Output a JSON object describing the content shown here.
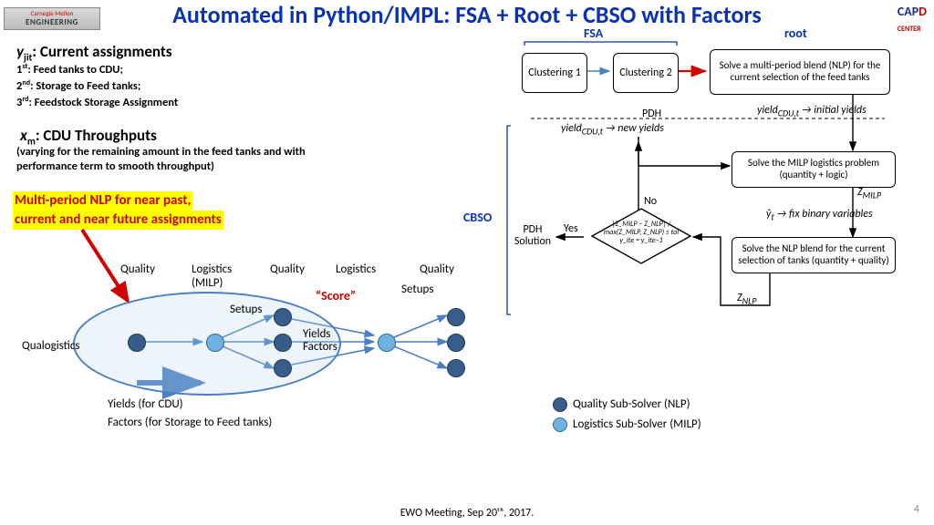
{
  "title": "Automated in Python/IMPL: FSA + Root + CBSO with Factors",
  "logoLeft": {
    "line1": "Carnegie Mellon",
    "line2": "ENGINEERING"
  },
  "logoRight": {
    "a": "CAP",
    "b": "D",
    "sub": "CENTER"
  },
  "left": {
    "yjit_h": "y",
    "yjit_sub": "jit",
    "yjit_t": ": Current assignments",
    "l1a": "1",
    "l1b": "st",
    "l1c": ": Feed tanks to CDU;",
    "l2a": "2",
    "l2b": "nd",
    "l2c": ": Storage to Feed tanks;",
    "l3a": "3",
    "l3b": "rd",
    "l3c": ": Feedstock Storage Assignment",
    "xm_h": "x",
    "xm_sub": "m",
    "xm_t": ":  CDU Throughputs",
    "xm_p": "(varying for the remaining amount in the feed tanks and with performance term to smooth throughput)",
    "hl1": "Multi-period NLP for near past,",
    "hl2": "current and near future assignments"
  },
  "flow": {
    "fsa": "FSA",
    "root": "root",
    "cbso": "CBSO",
    "c1": "Clustering 1",
    "c2": "Clustering 2",
    "b1": "Solve a multi-period blend (NLP) for the current selection of the feed tanks",
    "pdh": "PDH",
    "y_new": "yield",
    "y_new2": " → new yields",
    "cdu": "CDU,t",
    "y_init": "yield",
    "y_init2": " → initial yields",
    "b2": "Solve the MILP logistics problem (quantity + logic)",
    "zmilp": "Z",
    "zmilp_s": "MILP",
    "ybar": "ŷ",
    "ybar_s": "t",
    "ybar_t": " → fix binary variables",
    "b3": "Solve the NLP blend for the current selection of tanks (quantity + quality)",
    "znlp": "Z",
    "znlp_s": "NLP",
    "dec": "|Z_MILP − Z_NLP| / max(Z_MILP, Z_NLP) ≤ tol    y_ite = y_ite−1",
    "pdhSol": "PDH Solution",
    "yes": "Yes",
    "no": "No"
  },
  "bub": {
    "quality": "Quality",
    "logistics": "Logistics",
    "milp": "(MILP)",
    "setups": "Setups",
    "qual2": "Quality",
    "log2": "Logistics",
    "score": "“Score”",
    "yields": "Yields",
    "factors": "Factors",
    "qualo": "Qualogistics",
    "yieldc": "Yields (for CDU)",
    "factc": "Factors (for Storage to Feed tanks)"
  },
  "legend": {
    "q": "Quality Sub-Solver (NLP)",
    "l": "Logistics Sub-Solver (MILP)"
  },
  "footer": "EWO Meeting, Sep 20ᵗʰ, 2017.",
  "page": "4"
}
